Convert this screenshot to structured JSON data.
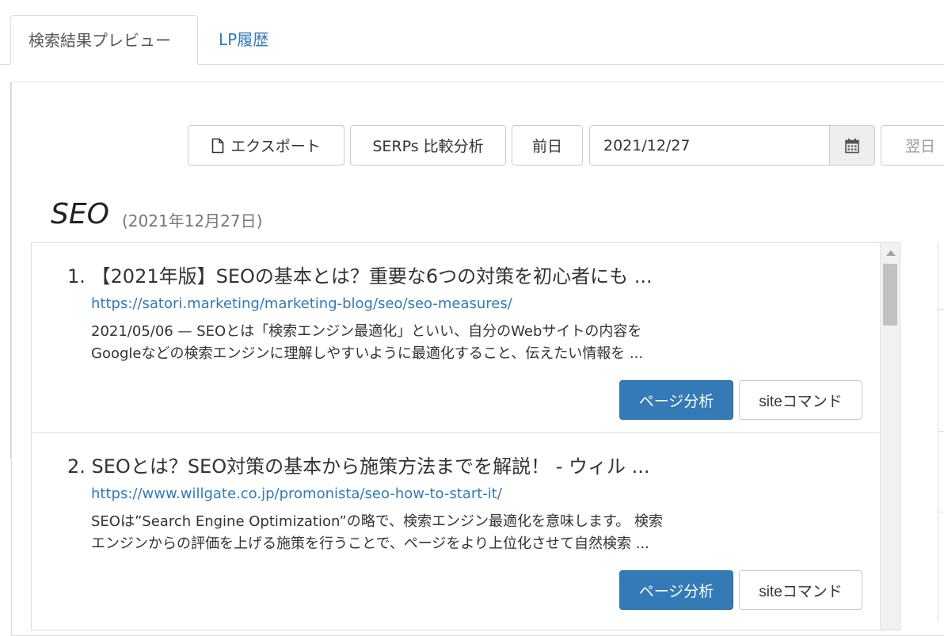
{
  "tabs": [
    {
      "label": "検索結果プレビュー",
      "active": true
    },
    {
      "label": "LP履歴",
      "active": false
    }
  ],
  "toolbar": {
    "export_label": "エクスポート",
    "serps_label": "SERPs 比較分析",
    "prev_label": "前日",
    "date_value": "2021/12/27",
    "next_label": "翌日"
  },
  "keyword": {
    "title": "SEO",
    "date": "(2021年12月27日)"
  },
  "results": [
    {
      "title": "1. 【2021年版】SEOの基本とは？重要な6つの対策を初心者にも ...",
      "url": "https://satori.marketing/marketing-blog/seo/seo-measures/",
      "snippet_line1": "2021/05/06 — SEOとは「検索エンジン最適化」といい、自分のWebサイトの内容を",
      "snippet_line2": "Googleなどの検索エンジンに理解しやすいように最適化すること、伝えたい情報を ...",
      "page_button": "ページ分析",
      "site_button": "siteコマンド"
    },
    {
      "title": "2. SEOとは？SEO対策の基本から施策方法までを解説！ - ウィル ...",
      "url": "https://www.willgate.co.jp/promonista/seo-how-to-start-it/",
      "snippet_line1": "SEOは”Search Engine Optimization”の略で、検索エンジン最適化を意味します。 検索",
      "snippet_line2": "エンジンからの評価を上げる施策を行うことで、ページをより上位化させて自然検索 ...",
      "page_button": "ページ分析",
      "site_button": "siteコマンド"
    }
  ],
  "colors": {
    "primary": "#337ab7",
    "link": "#337ab7",
    "border": "#dddddd"
  }
}
